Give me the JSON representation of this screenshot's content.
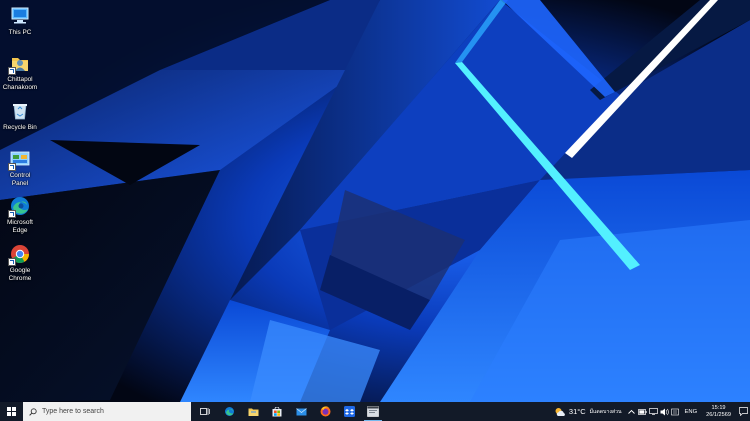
{
  "desktop": {
    "icons": [
      {
        "label": "This PC",
        "icon": "this-pc-icon"
      },
      {
        "label": "Chittapol\nChanakoom",
        "icon": "user-folder-icon"
      },
      {
        "label": "Recycle Bin",
        "icon": "recycle-bin-icon"
      },
      {
        "label": "Control Panel",
        "icon": "control-panel-icon"
      },
      {
        "label": "Microsoft\nEdge",
        "icon": "edge-icon"
      },
      {
        "label": "Google\nChrome",
        "icon": "chrome-icon"
      }
    ]
  },
  "taskbar": {
    "search_placeholder": "Type here to search",
    "apps": [
      {
        "name": "task-view",
        "icon": "task-view-icon"
      },
      {
        "name": "edge",
        "icon": "edge-icon"
      },
      {
        "name": "file-explorer",
        "icon": "folder-icon"
      },
      {
        "name": "store",
        "icon": "store-icon"
      },
      {
        "name": "mail",
        "icon": "mail-icon"
      },
      {
        "name": "firefox",
        "icon": "firefox-icon"
      },
      {
        "name": "dropbox",
        "icon": "dropbox-icon"
      },
      {
        "name": "app-window",
        "icon": "app-window-icon"
      }
    ],
    "tray": {
      "temperature": "31°C",
      "weather_text": "มีแดดบางส่วน",
      "language": "ENG",
      "time": "15:19",
      "date": "26/1/2569"
    }
  },
  "colors": {
    "taskbar_bg": "#121a28",
    "wallpaper_accent": "#1e6cff",
    "highlight": "#76b9ed"
  }
}
